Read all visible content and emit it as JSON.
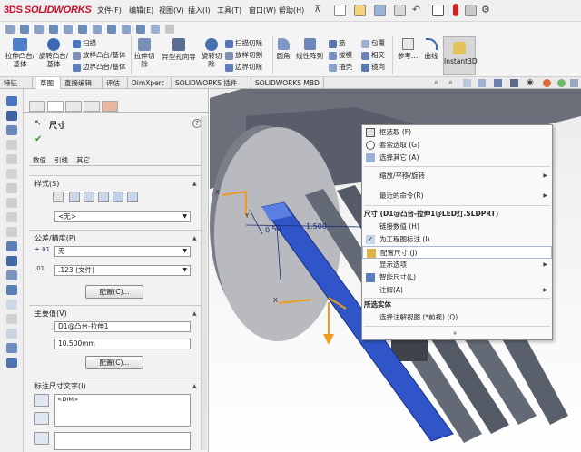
{
  "app": {
    "logo_text": "SOLIDWORKS",
    "logo_mark": "3DS"
  },
  "menu": [
    "文件(F)",
    "编辑(E)",
    "视图(V)",
    "插入(I)",
    "工具(T)",
    "窗口(W)",
    "帮助(H)"
  ],
  "ribbon": {
    "boss_extrude": "拉伸凸台/基体",
    "boss_revolve": "旋转凸台/基体",
    "sweep": "扫描",
    "loft": "放样凸台/基体",
    "boundary": "边界凸台/基体",
    "cut_extrude": "拉伸切除",
    "hole_wizard": "异型孔向导",
    "cut_revolve": "旋转切除",
    "swept_cut": "扫描切除",
    "lofted_cut": "放样切割",
    "boundary_cut": "边界切除",
    "fillet": "圆角",
    "linear_pattern": "线性阵列",
    "rib": "筋",
    "draft": "拔模",
    "shell": "抽壳",
    "wrap": "包覆",
    "intersect": "相交",
    "mirror": "镜向",
    "reference": "参考...",
    "curves": "曲线",
    "instant3d": "Instant3D"
  },
  "tabs": [
    "特征",
    "草图",
    "直接编辑",
    "评估",
    "DimXpert",
    "SOLIDWORKS 插件",
    "SOLIDWORKS MBD"
  ],
  "property_manager": {
    "title": "尺寸",
    "help": "?",
    "subtabs": [
      "数值",
      "引线",
      "其它"
    ],
    "style": {
      "header": "样式(S)",
      "value": "<无>"
    },
    "tolerance": {
      "header": "公差/精度(P)",
      "type": "无",
      "precision": ".123 (文件)",
      "config_button": "配置(C)..."
    },
    "primary_value": {
      "header": "主要值(V)",
      "name": "D1@凸台-拉伸1",
      "value": "10.500mm",
      "config_button": "配置(C)..."
    },
    "dim_text": {
      "header": "标注尺寸文字(I)",
      "value": "<DIM>"
    }
  },
  "viewport": {
    "dim_label_1": "0.50",
    "dim_label_2": "1.500",
    "axis_x": "X",
    "axis_y": "Y",
    "axis_x2": "X"
  },
  "context_menu": {
    "group1": [
      {
        "label": "框选取 (F)",
        "icon": "box-select-icon"
      },
      {
        "label": "套索选取 (G)",
        "icon": "lasso-select-icon"
      },
      {
        "label": "选择其它 (A)",
        "icon": "select-other-icon"
      }
    ],
    "group2": [
      {
        "label": "缩放/平移/旋转",
        "submenu": true
      },
      {
        "label": "最近的命令(R)",
        "submenu": true
      }
    ],
    "section_dim": "尺寸 (D1@凸台-拉伸1@LED灯.SLDPRT)",
    "group3": [
      {
        "label": "链接数值 (H)",
        "icon": ""
      },
      {
        "label": "为工程图标注 (I)",
        "icon": "check-icon"
      },
      {
        "label": "配置尺寸 (J)",
        "icon": "config-dim-icon"
      },
      {
        "label": "显示选项",
        "submenu": true
      },
      {
        "label": "智能尺寸(L)",
        "icon": "smart-dim-icon"
      },
      {
        "label": "注解(A)",
        "submenu": true
      }
    ],
    "section_selected": "所选实体",
    "group4": [
      {
        "label": "选择注解视图 (*前视) (Q)"
      }
    ],
    "more": "»"
  },
  "colors": {
    "highlight": "#2f55c8",
    "arrow": "#e02020",
    "triad": "#f09a1e",
    "body": "#5e6470"
  }
}
